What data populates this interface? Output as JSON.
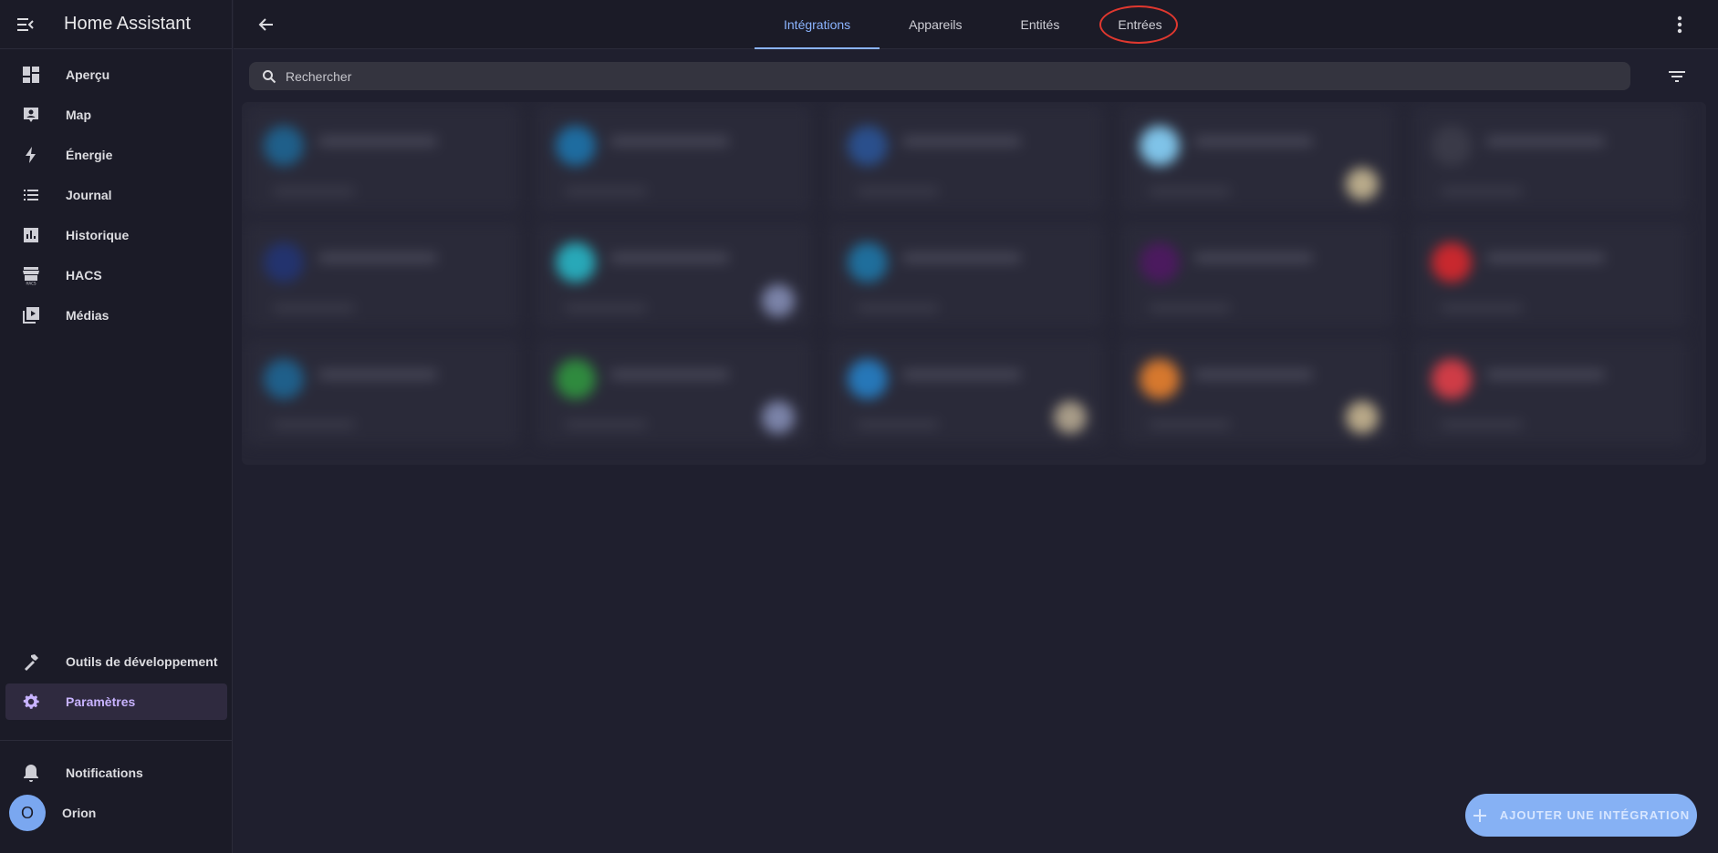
{
  "app": {
    "title": "Home Assistant"
  },
  "sidebar": {
    "items": [
      {
        "label": "Aperçu",
        "icon": "dashboard-icon"
      },
      {
        "label": "Map",
        "icon": "map-account-icon"
      },
      {
        "label": "Énergie",
        "icon": "lightning-icon"
      },
      {
        "label": "Journal",
        "icon": "list-icon"
      },
      {
        "label": "Historique",
        "icon": "chart-box-icon"
      },
      {
        "label": "HACS",
        "icon": "hacs-store-icon"
      },
      {
        "label": "Médias",
        "icon": "play-box-multiple-icon"
      }
    ],
    "dev_tools": {
      "label": "Outils de développement",
      "icon": "hammer-icon"
    },
    "settings": {
      "label": "Paramètres",
      "icon": "gear-icon",
      "active": true
    },
    "notifications": {
      "label": "Notifications",
      "icon": "bell-icon"
    },
    "user": {
      "label": "Orion",
      "initial": "O"
    }
  },
  "topbar": {
    "tabs": [
      {
        "label": "Intégrations",
        "active": true
      },
      {
        "label": "Appareils"
      },
      {
        "label": "Entités"
      },
      {
        "label": "Entrées",
        "highlighted": true
      }
    ]
  },
  "search": {
    "placeholder": "Rechercher"
  },
  "fab": {
    "label": "AJOUTER UNE INTÉGRATION"
  },
  "colors": {
    "accent": "#8bb4ff",
    "active_nav": "#c8b3ff",
    "highlight_circle": "#e0382f",
    "fab": "#86b1f4"
  }
}
